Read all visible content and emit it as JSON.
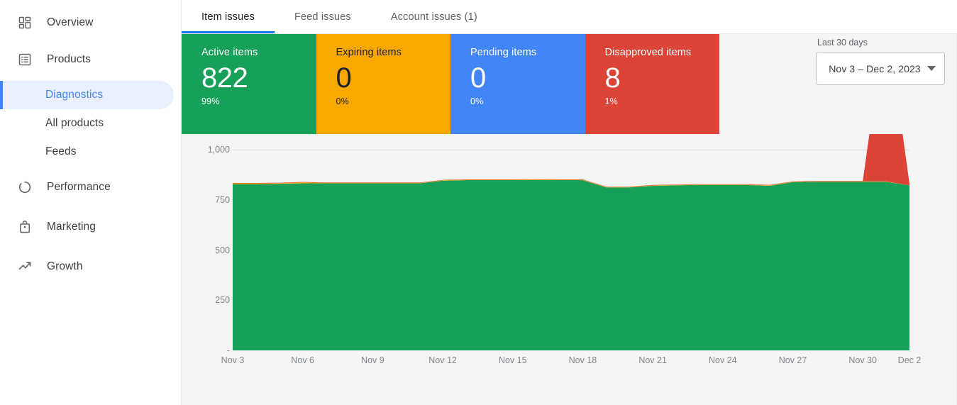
{
  "sidebar": {
    "items": [
      {
        "label": "Overview",
        "icon": "dashboard-icon",
        "type": "top"
      },
      {
        "label": "Products",
        "icon": "list-icon",
        "type": "top"
      },
      {
        "label": "Diagnostics",
        "icon": "",
        "type": "sub",
        "active": true
      },
      {
        "label": "All products",
        "icon": "",
        "type": "sub",
        "active": false
      },
      {
        "label": "Feeds",
        "icon": "",
        "type": "sub",
        "active": false
      },
      {
        "label": "Performance",
        "icon": "donut-icon",
        "type": "top"
      },
      {
        "label": "Marketing",
        "icon": "bag-icon",
        "type": "top"
      },
      {
        "label": "Growth",
        "icon": "trending-up-icon",
        "type": "top"
      }
    ]
  },
  "tabs": [
    {
      "label": "Item issues",
      "active": true
    },
    {
      "label": "Feed issues",
      "active": false
    },
    {
      "label": "Account issues (1)",
      "active": false
    }
  ],
  "cards": [
    {
      "title": "Active items",
      "value": "822",
      "percent": "99%",
      "color": "#17a05a"
    },
    {
      "title": "Expiring items",
      "value": "0",
      "percent": "0%",
      "color": "#f9a800"
    },
    {
      "title": "Pending items",
      "value": "0",
      "percent": "0%",
      "color": "#4285f4"
    },
    {
      "title": "Disapproved items",
      "value": "8",
      "percent": "1%",
      "color": "#db4437"
    }
  ],
  "date_range": {
    "label": "Last 30 days",
    "value": "Nov 3 – Dec 2, 2023"
  },
  "chart_data": {
    "type": "area",
    "title": "",
    "xlabel": "",
    "ylabel": "",
    "ylim": [
      0,
      1000
    ],
    "yticks": [
      0,
      250,
      500,
      750,
      1000
    ],
    "ytick_labels": [
      "-",
      "250",
      "500",
      "750",
      "1,000"
    ],
    "grid": true,
    "legend": "none",
    "x": [
      "Nov 3",
      "Nov 4",
      "Nov 5",
      "Nov 6",
      "Nov 7",
      "Nov 8",
      "Nov 9",
      "Nov 10",
      "Nov 11",
      "Nov 12",
      "Nov 13",
      "Nov 14",
      "Nov 15",
      "Nov 16",
      "Nov 17",
      "Nov 18",
      "Nov 19",
      "Nov 20",
      "Nov 21",
      "Nov 22",
      "Nov 23",
      "Nov 24",
      "Nov 25",
      "Nov 26",
      "Nov 27",
      "Nov 28",
      "Nov 29",
      "Nov 30",
      "Dec 1",
      "Dec 2"
    ],
    "xtick_labels": [
      "Nov 3",
      "Nov 6",
      "Nov 9",
      "Nov 12",
      "Nov 15",
      "Nov 18",
      "Nov 21",
      "Nov 24",
      "Nov 27",
      "Nov 30",
      "Dec 2"
    ],
    "stacked": true,
    "series": [
      {
        "name": "Active items",
        "color": "#17a05a",
        "values": [
          828,
          828,
          830,
          832,
          832,
          832,
          832,
          832,
          832,
          845,
          848,
          848,
          848,
          848,
          848,
          848,
          812,
          812,
          820,
          822,
          824,
          824,
          824,
          820,
          838,
          840,
          840,
          840,
          840,
          822
        ]
      },
      {
        "name": "Expiring items",
        "color": "#f9a800",
        "values": [
          4,
          4,
          3,
          5,
          2,
          2,
          2,
          2,
          2,
          2,
          2,
          2,
          2,
          3,
          2,
          2,
          2,
          2,
          2,
          2,
          2,
          2,
          2,
          2,
          2,
          2,
          2,
          2,
          2,
          0
        ]
      },
      {
        "name": "Pending items",
        "color": "#4285f4",
        "values": [
          0,
          0,
          0,
          0,
          0,
          0,
          0,
          0,
          0,
          0,
          0,
          0,
          0,
          0,
          0,
          0,
          0,
          0,
          0,
          0,
          0,
          0,
          0,
          0,
          0,
          0,
          0,
          0,
          0,
          0
        ]
      },
      {
        "name": "Disapproved items",
        "color": "#db4437",
        "values": [
          2,
          2,
          2,
          2,
          2,
          2,
          2,
          2,
          2,
          2,
          2,
          2,
          2,
          2,
          2,
          2,
          2,
          2,
          2,
          2,
          2,
          2,
          2,
          2,
          2,
          2,
          2,
          2,
          830,
          8
        ]
      }
    ]
  }
}
